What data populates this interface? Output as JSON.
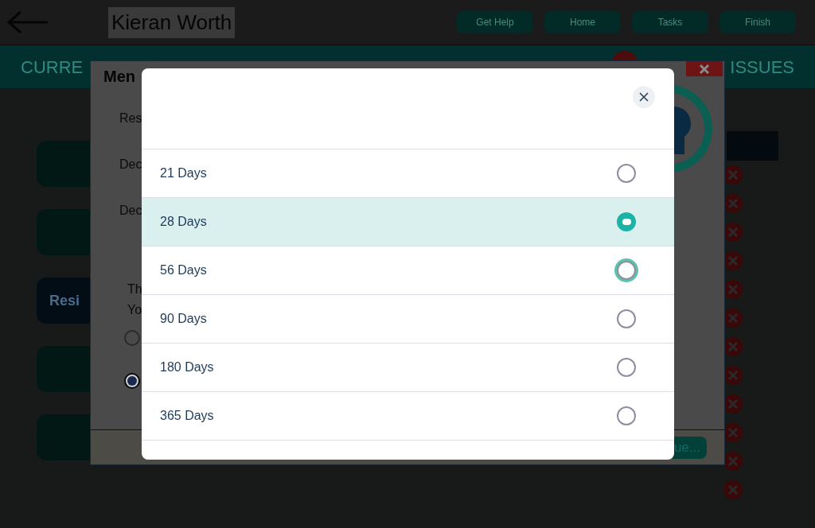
{
  "header": {
    "title": "Kieran Worth",
    "buttons": [
      "Get Help",
      "Home",
      "Tasks",
      "Finish"
    ]
  },
  "banner": {
    "left_text": "CURRE",
    "right_text": "ISSUES"
  },
  "side_buttons": [
    {
      "kind": "plain"
    },
    {
      "kind": "plain"
    },
    {
      "kind": "dark",
      "label": "Resi"
    },
    {
      "kind": "plain"
    },
    {
      "kind": "plain"
    }
  ],
  "background_dialog": {
    "title": "Men",
    "lines": [
      "Res",
      "Dec",
      "Dec"
    ],
    "question_lines": [
      "Th",
      "Yo"
    ],
    "radios": [
      {
        "selected": false
      },
      {
        "selected": true
      }
    ],
    "continue_button": "ue..."
  },
  "modal": {
    "options": [
      {
        "label": "21 Days",
        "selected": false,
        "focused": false
      },
      {
        "label": "28 Days",
        "selected": true,
        "focused": false
      },
      {
        "label": "56 Days",
        "selected": false,
        "focused": true
      },
      {
        "label": "90 Days",
        "selected": false,
        "focused": false
      },
      {
        "label": "180 Days",
        "selected": false,
        "focused": false
      },
      {
        "label": "365 Days",
        "selected": false,
        "focused": false
      }
    ]
  }
}
